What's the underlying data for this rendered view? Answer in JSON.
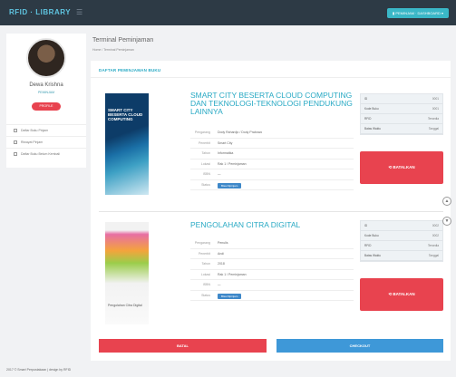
{
  "header": {
    "brand": "RFID · LIBRARY",
    "menu_icon": "menu-icon",
    "user_button": "▮ PEMINJAM · DASHBOARD ▾"
  },
  "sidebar": {
    "user_name": "Dewa Krishna",
    "user_role": "PEMINJAM",
    "profile_button": "PROFILE",
    "items": [
      {
        "icon": "catalog-icon",
        "label": "Daftar Buku Pinjam"
      },
      {
        "icon": "history-icon",
        "label": "Riwayat Pinjam"
      },
      {
        "icon": "list-icon",
        "label": "Daftar Buku Belum Kembali"
      }
    ]
  },
  "page": {
    "title": "Terminal Peminjaman",
    "breadcrumb": "Home / Terminal Peminjaman"
  },
  "panel": {
    "heading": "DAFTAR PEMINJAMAN BUKU"
  },
  "books": [
    {
      "title": "SMART CITY BESERTA CLOUD COMPUTING DAN TEKNOLOGI-TEKNOLOGI PENDUKUNG LAINNYA",
      "cover_text": "SMART CITY BESERTA CLOUD COMPUTING",
      "meta": [
        {
          "label": "Pengarang",
          "value": "Dody Rahardjo / Dody Prabowo"
        },
        {
          "label": "Penerbit",
          "value": "Smart City"
        },
        {
          "label": "Tahun",
          "value": "Informatika"
        },
        {
          "label": "Lokasi",
          "value": "Rak 1 / Peminjaman"
        },
        {
          "label": "ISBN",
          "value": "—"
        }
      ],
      "status_label": "Status",
      "status_chip": "Bisa Dipinjam",
      "stats": [
        {
          "label": "ID",
          "value": "0001"
        },
        {
          "label": "Kode Buku",
          "value": "0001"
        },
        {
          "label": "RFID",
          "value": "Tersedia"
        },
        {
          "label": "Batas Waktu",
          "value": "Tanggal"
        }
      ],
      "action": "⟲ BATALKAN"
    },
    {
      "title": "PENGOLAHAN CITRA DIGITAL",
      "cover_text": "Pengolahan Citra Digital",
      "meta": [
        {
          "label": "Pengarang",
          "value": "Penulis"
        },
        {
          "label": "Penerbit",
          "value": "Andi"
        },
        {
          "label": "Tahun",
          "value": "2018"
        },
        {
          "label": "Lokasi",
          "value": "Rak 1 / Peminjaman"
        },
        {
          "label": "ISBN",
          "value": "—"
        }
      ],
      "status_label": "Status",
      "status_chip": "Bisa Dipinjam",
      "stats": [
        {
          "label": "ID",
          "value": "0002"
        },
        {
          "label": "Kode Buku",
          "value": "0002"
        },
        {
          "label": "RFID",
          "value": "Tersedia"
        },
        {
          "label": "Batas Waktu",
          "value": "Tanggal"
        }
      ],
      "action": "⟲ BATALKAN"
    }
  ],
  "footer_buttons": {
    "back": "BATAL",
    "checkout": "CHECKOUT"
  },
  "side_icons": [
    "up-icon",
    "down-icon"
  ],
  "copyright": "2017 © Smart Perpustakaan | design by RFID",
  "colors": {
    "accent": "#28a9c4",
    "danger": "#e8434f",
    "primary": "#3e98d8",
    "topbar": "#2d3a45"
  }
}
